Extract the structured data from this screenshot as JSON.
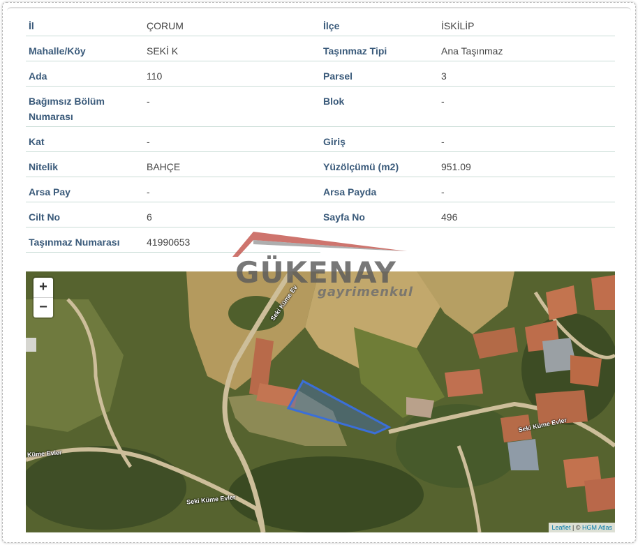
{
  "fields": [
    {
      "l1": "İl",
      "v1": "ÇORUM",
      "l2": "İlçe",
      "v2": "İSKİLİP"
    },
    {
      "l1": "Mahalle/Köy",
      "v1": "SEKİ K",
      "l2": "Taşınmaz Tipi",
      "v2": "Ana Taşınmaz"
    },
    {
      "l1": "Ada",
      "v1": "110",
      "l2": "Parsel",
      "v2": "3"
    },
    {
      "l1": "Bağımsız Bölüm Numarası",
      "v1": "-",
      "l2": "Blok",
      "v2": "-"
    },
    {
      "l1": "Kat",
      "v1": "-",
      "l2": "Giriş",
      "v2": "-"
    },
    {
      "l1": "Nitelik",
      "v1": "BAHÇE",
      "l2": "Yüzölçümü (m2)",
      "v2": "951.09"
    },
    {
      "l1": "Arsa Pay",
      "v1": "-",
      "l2": "Arsa Payda",
      "v2": "-"
    },
    {
      "l1": "Cilt No",
      "v1": "6",
      "l2": "Sayfa No",
      "v2": "496"
    },
    {
      "l1": "Taşınmaz Numarası",
      "v1": "41990653",
      "l2": "",
      "v2": ""
    }
  ],
  "watermark": {
    "name": "GÜKENAY",
    "subtitle": "gayrimenkul"
  },
  "map": {
    "zoom_in": "+",
    "zoom_out": "−",
    "road_labels": [
      "Seki Küme Ev",
      "Küme Evler",
      "Seki Küme Evler",
      "Seki Küme Evler"
    ],
    "attribution": {
      "leaflet": "Leaflet",
      "separator": " | © ",
      "source": "HGM Atlas"
    },
    "parcel_color": "#3b6fd8"
  }
}
